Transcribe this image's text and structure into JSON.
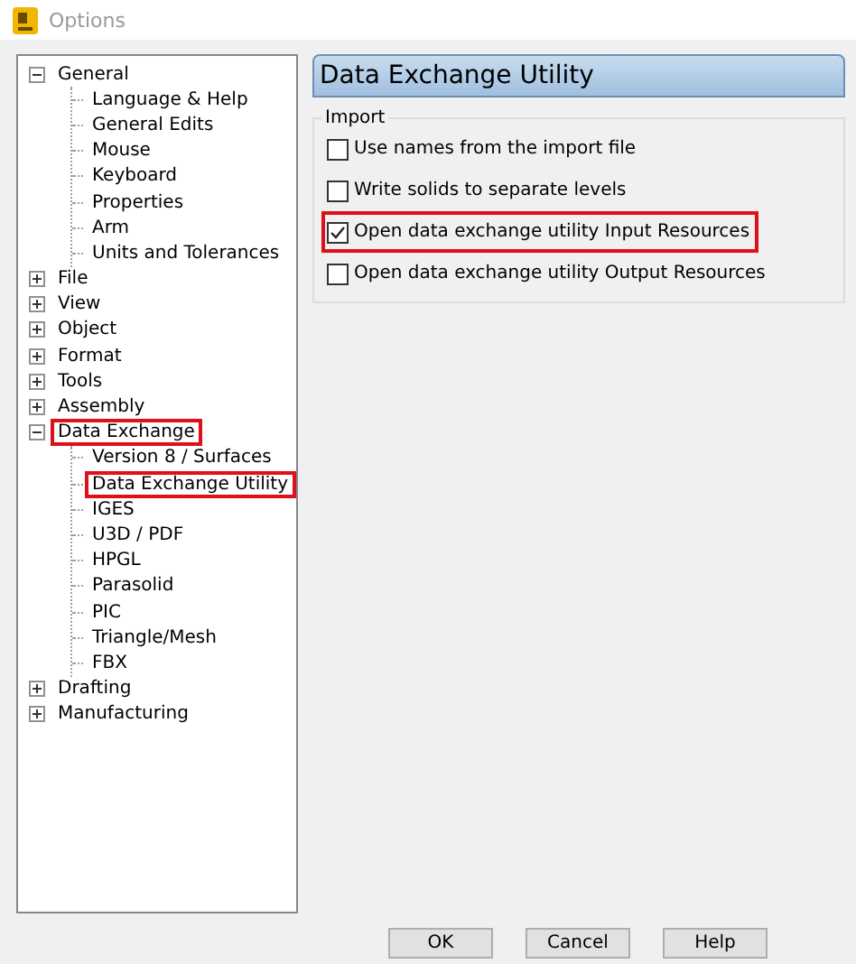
{
  "window": {
    "title": "Options"
  },
  "tree": [
    {
      "label": "General",
      "expanded": true,
      "highlighted": false,
      "children": [
        {
          "label": "Language & Help",
          "highlighted": false
        },
        {
          "label": "General Edits",
          "highlighted": false
        },
        {
          "label": "Mouse",
          "highlighted": false
        },
        {
          "label": "Keyboard",
          "highlighted": false
        },
        {
          "label": "Properties",
          "highlighted": false
        },
        {
          "label": "Arm",
          "highlighted": false
        },
        {
          "label": "Units and Tolerances",
          "highlighted": false
        }
      ]
    },
    {
      "label": "File",
      "expanded": false,
      "highlighted": false
    },
    {
      "label": "View",
      "expanded": false,
      "highlighted": false
    },
    {
      "label": "Object",
      "expanded": false,
      "highlighted": false
    },
    {
      "label": "Format",
      "expanded": false,
      "highlighted": false
    },
    {
      "label": "Tools",
      "expanded": false,
      "highlighted": false
    },
    {
      "label": "Assembly",
      "expanded": false,
      "highlighted": false
    },
    {
      "label": "Data Exchange",
      "expanded": true,
      "highlighted": true,
      "children": [
        {
          "label": "Version 8 / Surfaces",
          "highlighted": false
        },
        {
          "label": "Data Exchange Utility",
          "highlighted": true
        },
        {
          "label": "IGES",
          "highlighted": false
        },
        {
          "label": "U3D / PDF",
          "highlighted": false
        },
        {
          "label": "HPGL",
          "highlighted": false
        },
        {
          "label": "Parasolid",
          "highlighted": false
        },
        {
          "label": "PIC",
          "highlighted": false
        },
        {
          "label": "Triangle/Mesh",
          "highlighted": false
        },
        {
          "label": "FBX",
          "highlighted": false
        }
      ]
    },
    {
      "label": "Drafting",
      "expanded": false,
      "highlighted": false
    },
    {
      "label": "Manufacturing",
      "expanded": false,
      "highlighted": false
    }
  ],
  "page": {
    "title": "Data Exchange Utility",
    "group": "Import",
    "options": [
      {
        "label": "Use names from the import file",
        "checked": false,
        "highlighted": false
      },
      {
        "label": "Write solids to separate levels",
        "checked": false,
        "highlighted": false
      },
      {
        "label": "Open data exchange utility Input Resources",
        "checked": true,
        "highlighted": true
      },
      {
        "label": "Open data exchange utility Output Resources",
        "checked": false,
        "highlighted": false
      }
    ]
  },
  "buttons": [
    "OK",
    "Cancel",
    "Help"
  ]
}
